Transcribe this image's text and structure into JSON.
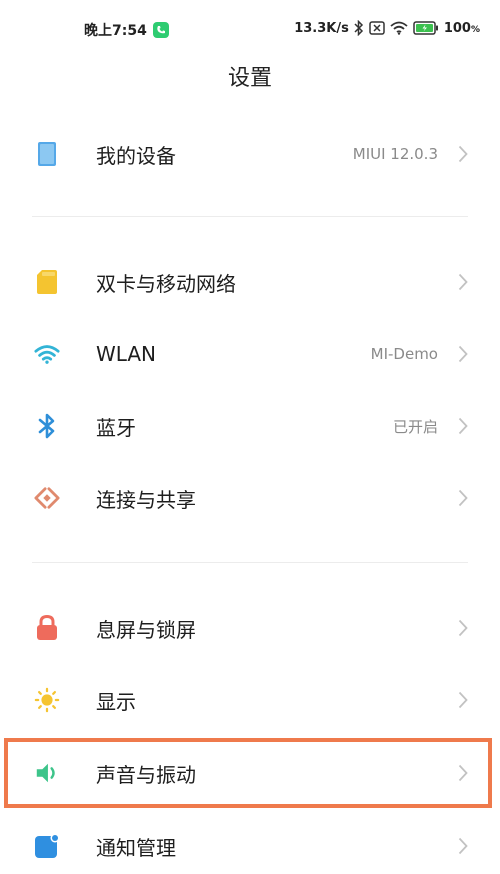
{
  "status_bar": {
    "time": "晚上7:54",
    "net_speed": "13.3K/s",
    "battery": "100",
    "battery_unit": "%"
  },
  "header": {
    "title": "设置"
  },
  "items": [
    {
      "label": "我的设备",
      "value": "MIUI 12.0.3",
      "icon": "tablet-icon"
    },
    {
      "label": "双卡与移动网络",
      "value": "",
      "icon": "sim-card-icon"
    },
    {
      "label": "WLAN",
      "value": "MI-Demo",
      "icon": "wifi-icon"
    },
    {
      "label": "蓝牙",
      "value": "已开启",
      "icon": "bluetooth-icon"
    },
    {
      "label": "连接与共享",
      "value": "",
      "icon": "share-connection-icon"
    },
    {
      "label": "息屏与锁屏",
      "value": "",
      "icon": "lock-icon"
    },
    {
      "label": "显示",
      "value": "",
      "icon": "sun-icon"
    },
    {
      "label": "声音与振动",
      "value": "",
      "icon": "speaker-icon"
    },
    {
      "label": "通知管理",
      "value": "",
      "icon": "notification-icon"
    }
  ],
  "colors": {
    "highlight": "#ef7a4c",
    "wifi": "#33b4d6",
    "bluetooth": "#2f8fd8",
    "sim": "#f4c430",
    "lock": "#ee6b5c",
    "sun": "#f5c431",
    "speaker": "#3dc48a",
    "notification": "#2f8fe0",
    "device": "#55a8e8"
  }
}
